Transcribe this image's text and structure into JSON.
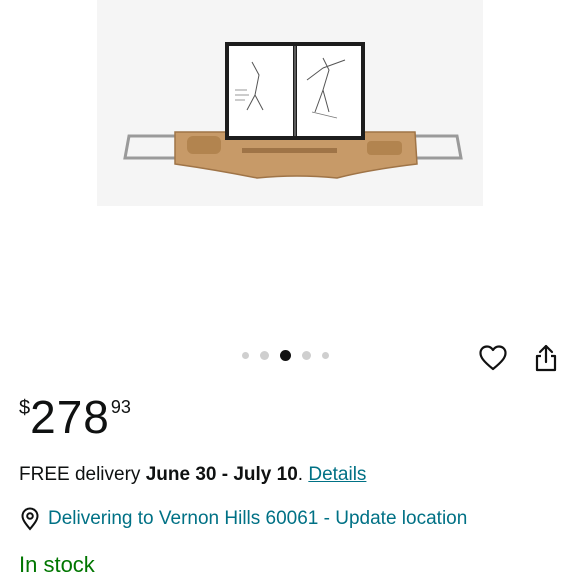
{
  "product": {
    "image_alt": "Bamboo bathtub caddy tray with open book"
  },
  "carousel": {
    "count": 5,
    "active_index": 2
  },
  "price": {
    "symbol": "$",
    "whole": "278",
    "fraction": "93"
  },
  "delivery": {
    "prefix": "FREE delivery ",
    "dates": "June 30 - July 10",
    "suffix": ". ",
    "details_link": "Details"
  },
  "location": {
    "text": "Delivering to Vernon Hills 60061 - Update location"
  },
  "availability": {
    "status": "In stock"
  },
  "icons": {
    "wishlist": "heart-icon",
    "share": "share-icon",
    "location": "location-pin-icon"
  },
  "colors": {
    "link": "#007185",
    "in_stock": "#007600",
    "text": "#0f1111"
  }
}
